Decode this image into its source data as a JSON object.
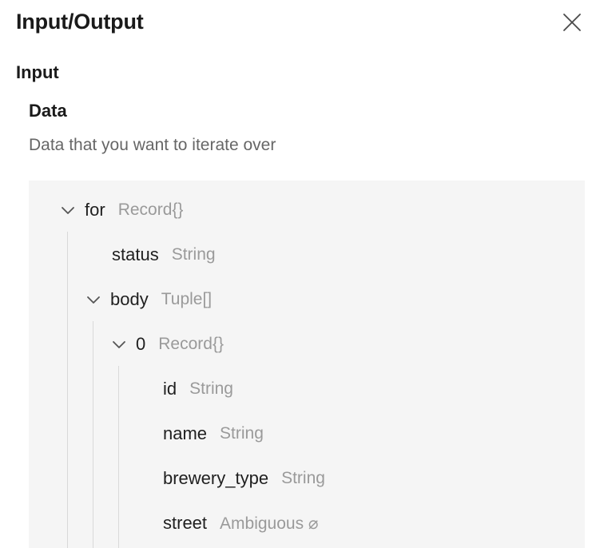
{
  "panel": {
    "title": "Input/Output",
    "close_icon": "close-icon"
  },
  "input": {
    "section_label": "Input",
    "field": {
      "label": "Data",
      "description": "Data that you want to iterate over"
    }
  },
  "tree": [
    {
      "key": "for",
      "type": "Record{}",
      "expanded": true,
      "depth": 0
    },
    {
      "key": "status",
      "type": "String",
      "depth": 1
    },
    {
      "key": "body",
      "type": "Tuple[]",
      "expanded": true,
      "depth": 1
    },
    {
      "key": "0",
      "type": "Record{}",
      "expanded": true,
      "depth": 2
    },
    {
      "key": "id",
      "type": "String",
      "depth": 3
    },
    {
      "key": "name",
      "type": "String",
      "depth": 3
    },
    {
      "key": "brewery_type",
      "type": "String",
      "depth": 3
    },
    {
      "key": "street",
      "type": "Ambiguous ⌀",
      "depth": 3
    }
  ]
}
